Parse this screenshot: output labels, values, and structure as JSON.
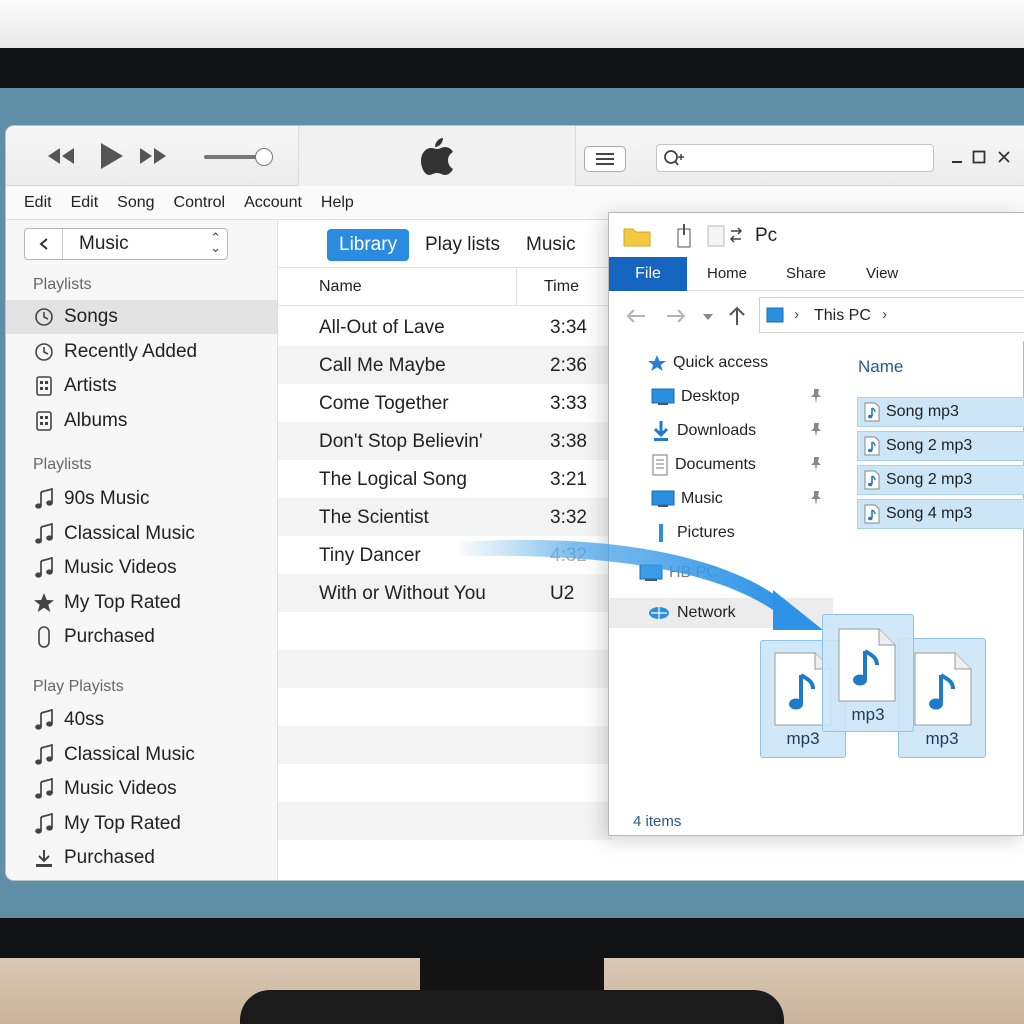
{
  "toolbar": {
    "search_placeholder": ""
  },
  "menu": [
    "Edit",
    "Edit",
    "Song",
    "Control",
    "Account",
    "Help"
  ],
  "sidebar": {
    "source": "Music",
    "sections": [
      {
        "title": "Playlists",
        "items": [
          {
            "label": "Songs",
            "icon": "clock-icon",
            "selected": true
          },
          {
            "label": "Recently Added",
            "icon": "clock-icon"
          },
          {
            "label": "Artists",
            "icon": "grid-icon"
          },
          {
            "label": "Albums",
            "icon": "grid-icon"
          }
        ]
      },
      {
        "title": "Playlists",
        "items": [
          {
            "label": "90s Music",
            "icon": "music-note-icon"
          },
          {
            "label": "Classical Music",
            "icon": "music-note-icon"
          },
          {
            "label": "Music Videos",
            "icon": "music-note-icon"
          },
          {
            "label": "My Top Rated",
            "icon": "star-icon"
          },
          {
            "label": "Purchased",
            "icon": "capsule-icon"
          }
        ]
      },
      {
        "title": "Play Playists",
        "items": [
          {
            "label": "40ss",
            "icon": "music-note-icon"
          },
          {
            "label": "Classical Music",
            "icon": "music-note-icon"
          },
          {
            "label": "Music Videos",
            "icon": "music-note-icon"
          },
          {
            "label": "My Top Rated",
            "icon": "music-note-icon"
          },
          {
            "label": "Purchased",
            "icon": "download-icon"
          }
        ]
      }
    ]
  },
  "tabs": [
    {
      "label": "Library",
      "active": true
    },
    {
      "label": "Play lists"
    },
    {
      "label": "Music"
    }
  ],
  "songs": {
    "columns": [
      "Name",
      "Time"
    ],
    "rows": [
      {
        "name": "All-Out of Lave",
        "time": "3:34"
      },
      {
        "name": "Call Me Maybe",
        "time": "2:36"
      },
      {
        "name": "Come Together",
        "time": "3:33"
      },
      {
        "name": "Don't Stop Believin'",
        "time": "3:38"
      },
      {
        "name": "The Logical Song",
        "time": "3:21"
      },
      {
        "name": "The Scientist",
        "time": "3:32"
      },
      {
        "name": "Tiny Dancer",
        "time": "4:32"
      },
      {
        "name": "With or Without You",
        "time": "U2"
      }
    ]
  },
  "explorer": {
    "title": "Pc",
    "ribbon": {
      "file": "File",
      "tabs": [
        "Home",
        "Share",
        "View"
      ]
    },
    "address": "This PC",
    "nav": [
      {
        "label": "Quick access",
        "icon": "star-icon"
      },
      {
        "label": "Desktop",
        "icon": "desktop-icon",
        "pinned": true
      },
      {
        "label": "Downloads",
        "icon": "download-icon",
        "pinned": true
      },
      {
        "label": "Documents",
        "icon": "document-icon",
        "pinned": true
      },
      {
        "label": "Music",
        "icon": "monitor-icon",
        "pinned": true
      },
      {
        "label": "Pictures",
        "icon": "pictures-icon"
      },
      {
        "label": "HB PC",
        "icon": "computer-icon"
      },
      {
        "label": "Network",
        "icon": "network-icon",
        "selected": true
      }
    ],
    "column_name": "Name",
    "files": [
      "Song mp3",
      "Song 2 mp3",
      "Song 2 mp3",
      "Song 4 mp3"
    ],
    "status": "4 items"
  },
  "drag": {
    "ghost_labels": [
      "mp3",
      "mp3",
      "mp3"
    ]
  },
  "colors": {
    "accent": "#2a8be0",
    "file_tab": "#1565c0",
    "selection": "#cce5f7",
    "screen_bg": "#5e8fa6",
    "music_icon": "#1e7bc8"
  }
}
